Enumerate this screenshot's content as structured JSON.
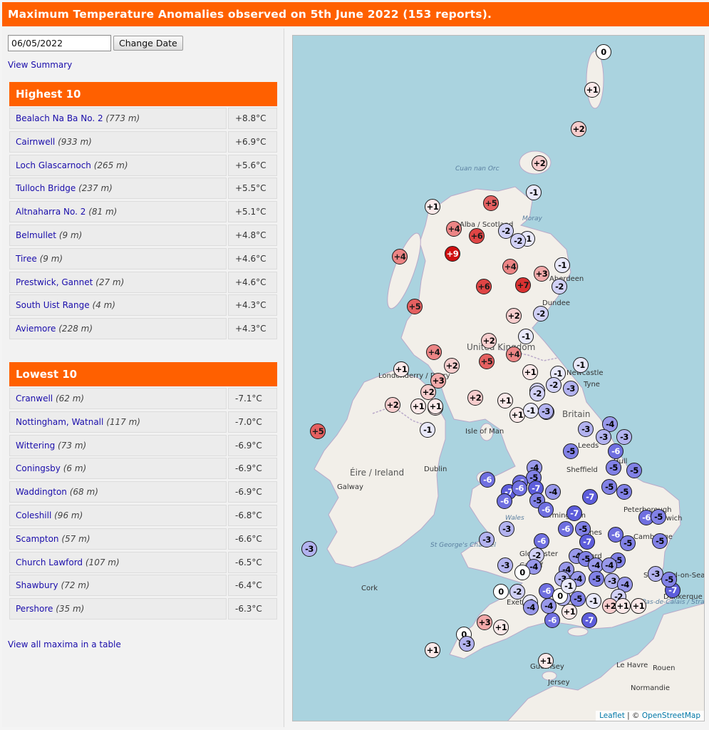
{
  "page_title": "Maximum Temperature Anomalies observed on 5th June 2022 (153 reports).",
  "date_input": "06/05/2022",
  "change_date_label": "Change Date",
  "view_summary_label": "View Summary",
  "view_all_label": "View all maxima in a table",
  "highest": {
    "title": "Highest 10",
    "rows": [
      {
        "name": "Bealach Na Ba No. 2",
        "elev": "(773 m)",
        "value": "+8.8°C"
      },
      {
        "name": "Cairnwell",
        "elev": "(933 m)",
        "value": "+6.9°C"
      },
      {
        "name": "Loch Glascarnoch",
        "elev": "(265 m)",
        "value": "+5.6°C"
      },
      {
        "name": "Tulloch Bridge",
        "elev": "(237 m)",
        "value": "+5.5°C"
      },
      {
        "name": "Altnaharra No. 2",
        "elev": "(81 m)",
        "value": "+5.1°C"
      },
      {
        "name": "Belmullet",
        "elev": "(9 m)",
        "value": "+4.8°C"
      },
      {
        "name": "Tiree",
        "elev": "(9 m)",
        "value": "+4.6°C"
      },
      {
        "name": "Prestwick, Gannet",
        "elev": "(27 m)",
        "value": "+4.6°C"
      },
      {
        "name": "South Uist Range",
        "elev": "(4 m)",
        "value": "+4.3°C"
      },
      {
        "name": "Aviemore",
        "elev": "(228 m)",
        "value": "+4.3°C"
      }
    ]
  },
  "lowest": {
    "title": "Lowest 10",
    "rows": [
      {
        "name": "Cranwell",
        "elev": "(62 m)",
        "value": "-7.1°C"
      },
      {
        "name": "Nottingham, Watnall",
        "elev": "(117 m)",
        "value": "-7.0°C"
      },
      {
        "name": "Wittering",
        "elev": "(73 m)",
        "value": "-6.9°C"
      },
      {
        "name": "Coningsby",
        "elev": "(6 m)",
        "value": "-6.9°C"
      },
      {
        "name": "Waddington",
        "elev": "(68 m)",
        "value": "-6.9°C"
      },
      {
        "name": "Coleshill",
        "elev": "(96 m)",
        "value": "-6.8°C"
      },
      {
        "name": "Scampton",
        "elev": "(57 m)",
        "value": "-6.6°C"
      },
      {
        "name": "Church Lawford",
        "elev": "(107 m)",
        "value": "-6.5°C"
      },
      {
        "name": "Shawbury",
        "elev": "(72 m)",
        "value": "-6.4°C"
      },
      {
        "name": "Pershore",
        "elev": "(35 m)",
        "value": "-6.3°C"
      }
    ]
  },
  "map": {
    "attribution_leaflet": "Leaflet",
    "attribution_sep": " | © ",
    "attribution_osm": "OpenStreetMap",
    "places": [
      {
        "t": "Aberdeen"
      },
      {
        "t": "Dundee"
      },
      {
        "t": "United Kingdom"
      },
      {
        "t": "Newcastle"
      },
      {
        "t": "Tyne"
      },
      {
        "t": "Britain"
      },
      {
        "t": "Leeds"
      },
      {
        "t": "Sheffield"
      },
      {
        "t": "Hull"
      },
      {
        "t": "Norwich"
      },
      {
        "t": "Birmingham"
      },
      {
        "t": "Cambridge"
      },
      {
        "t": "Gloucester"
      },
      {
        "t": "Oxford"
      },
      {
        "t": "Cardiff"
      },
      {
        "t": "London"
      },
      {
        "t": "Southend-on-Sea"
      },
      {
        "t": "Dunkerque"
      },
      {
        "t": "Exeter"
      },
      {
        "t": "Éire / Ireland"
      },
      {
        "t": "Galway"
      },
      {
        "t": "Dublin"
      },
      {
        "t": "Isle of Man"
      },
      {
        "t": "Londonderry / Derry"
      },
      {
        "t": "Cork"
      },
      {
        "t": "Le Havre"
      },
      {
        "t": "Rouen"
      },
      {
        "t": "Normandie"
      },
      {
        "t": "Guernsey"
      },
      {
        "t": "Jersey"
      },
      {
        "t": "Moray"
      },
      {
        "t": "Cuan nan Orc"
      },
      {
        "t": "Alba / Scotland"
      },
      {
        "t": "Wales"
      },
      {
        "t": "St George's Channel"
      },
      {
        "t": "Pas-de-Calais / Strait of Dover"
      },
      {
        "t": "Peterborough"
      },
      {
        "t": "Keynes"
      }
    ],
    "anomalies": [
      0,
      1,
      2,
      2,
      -1,
      5,
      1,
      4,
      6,
      -2,
      -1,
      -2,
      4,
      9,
      4,
      -1,
      3,
      7,
      6,
      -2,
      5,
      -2,
      2,
      2,
      -1,
      4,
      2,
      4,
      5,
      -1,
      1,
      3,
      -2,
      1,
      -1,
      -2,
      -3,
      2,
      2,
      1,
      1,
      2,
      1,
      1,
      1,
      -2,
      -3,
      -1,
      -3,
      5,
      -4,
      -1,
      -3,
      -3,
      -5,
      -3,
      -6,
      -4,
      -5,
      -6,
      -5,
      -5,
      -6,
      -7,
      -7,
      -5,
      -4,
      -6,
      -6,
      -5,
      -7,
      -6,
      -5,
      -7,
      -7,
      -6,
      -5,
      -6,
      -5,
      -6,
      -3,
      -3,
      -6,
      -5,
      -5,
      -4,
      -5,
      -5,
      -4,
      -4,
      -4,
      -5,
      -3,
      -4,
      -2,
      -3,
      -2,
      -4,
      -4,
      -3,
      -3,
      0,
      0,
      -2,
      -1,
      -1,
      1,
      2,
      1,
      1,
      3,
      1,
      0,
      -3,
      1,
      -7,
      -6,
      -7,
      -5,
      -3,
      -5,
      -6,
      -4,
      0,
      -1,
      -4,
      1,
      -3
    ]
  }
}
